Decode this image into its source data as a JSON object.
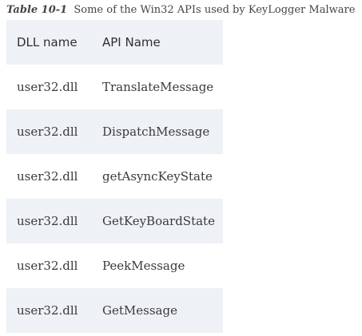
{
  "caption": {
    "label": "Table 10-1",
    "text": "Some of the Win32 APIs used by KeyLogger Malware"
  },
  "table": {
    "headers": [
      "DLL name",
      "API Name"
    ],
    "rows": [
      [
        "user32.dll",
        "TranslateMessage"
      ],
      [
        "user32.dll",
        "DispatchMessage"
      ],
      [
        "user32.dll",
        "getAsyncKeyState"
      ],
      [
        "user32.dll",
        "GetKeyBoardState"
      ],
      [
        "user32.dll",
        "PeekMessage"
      ],
      [
        "user32.dll",
        "GetMessage"
      ]
    ]
  }
}
